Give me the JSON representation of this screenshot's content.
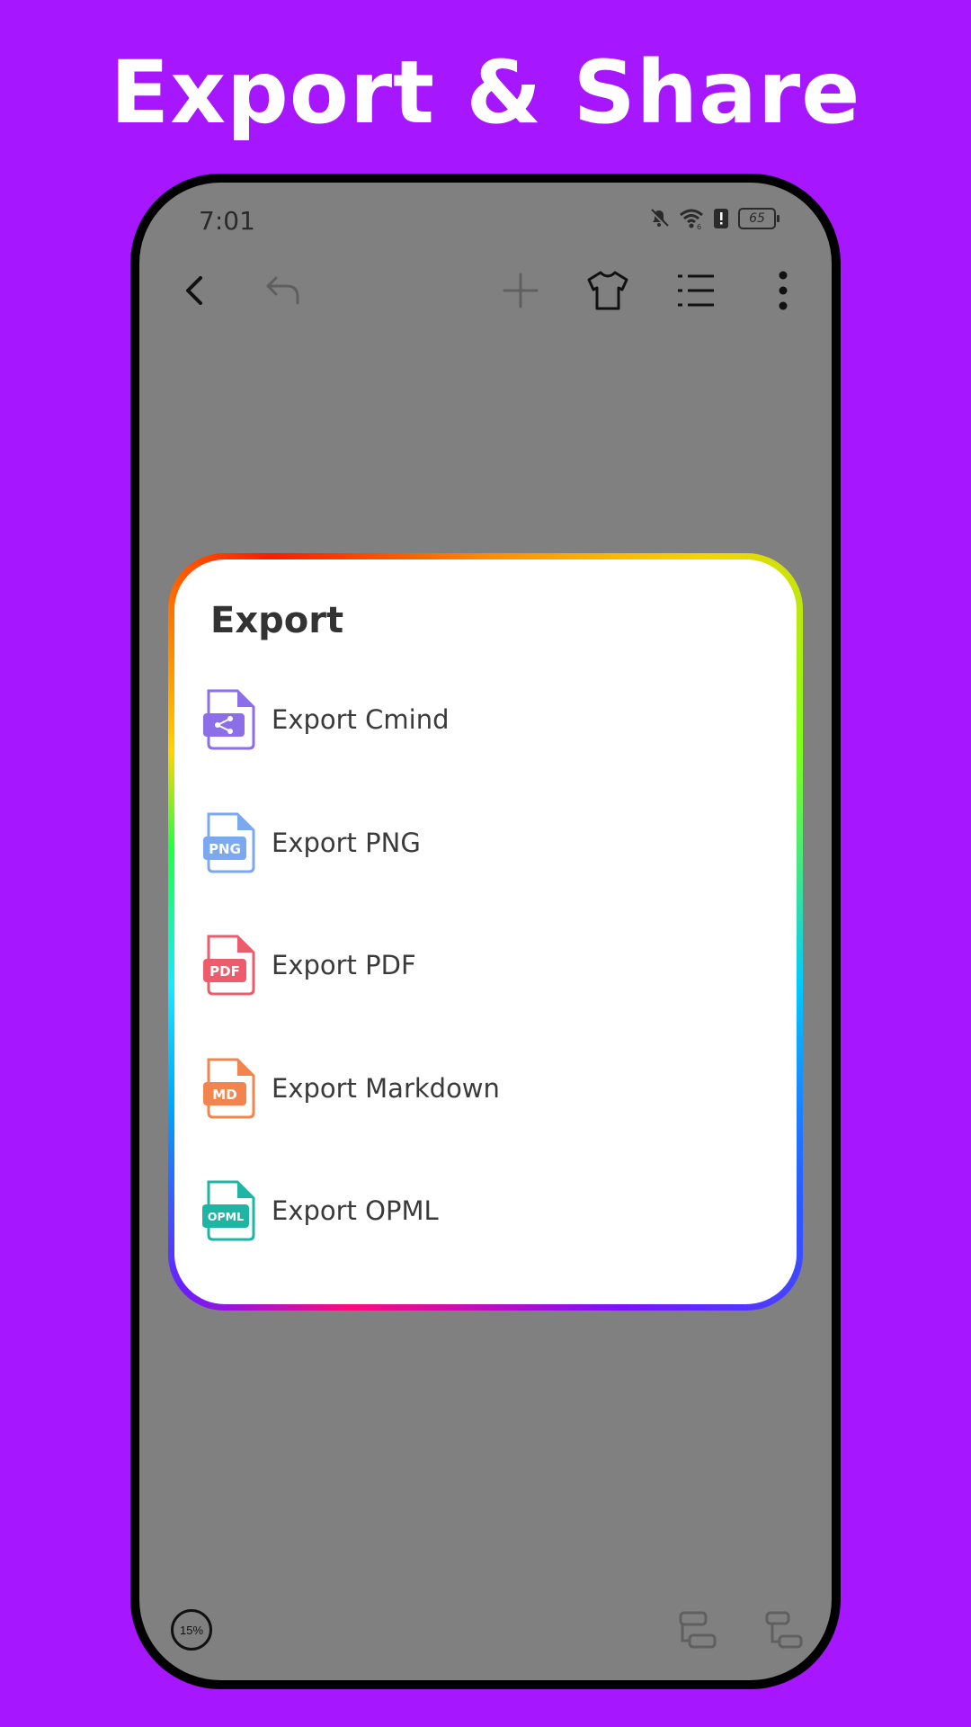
{
  "headline": "Export & Share",
  "status_bar": {
    "time": "7:01",
    "battery": "65"
  },
  "dialog": {
    "title": "Export",
    "items": [
      {
        "label": "Export Cmind",
        "icon": "cmind-file-icon",
        "badge": "",
        "color": "#8C6FE8"
      },
      {
        "label": "Export PNG",
        "icon": "png-file-icon",
        "badge": "PNG",
        "color": "#7BA9EF"
      },
      {
        "label": "Export PDF",
        "icon": "pdf-file-icon",
        "badge": "PDF",
        "color": "#EC5C6C"
      },
      {
        "label": "Export Markdown",
        "icon": "markdown-file-icon",
        "badge": "MD",
        "color": "#F2854E"
      },
      {
        "label": "Export OPML",
        "icon": "opml-file-icon",
        "badge": "OPML",
        "color": "#1FB5A4"
      }
    ]
  },
  "zoom_level": "15%",
  "colors": {
    "background": "#A616FF",
    "screen": "#808080"
  }
}
